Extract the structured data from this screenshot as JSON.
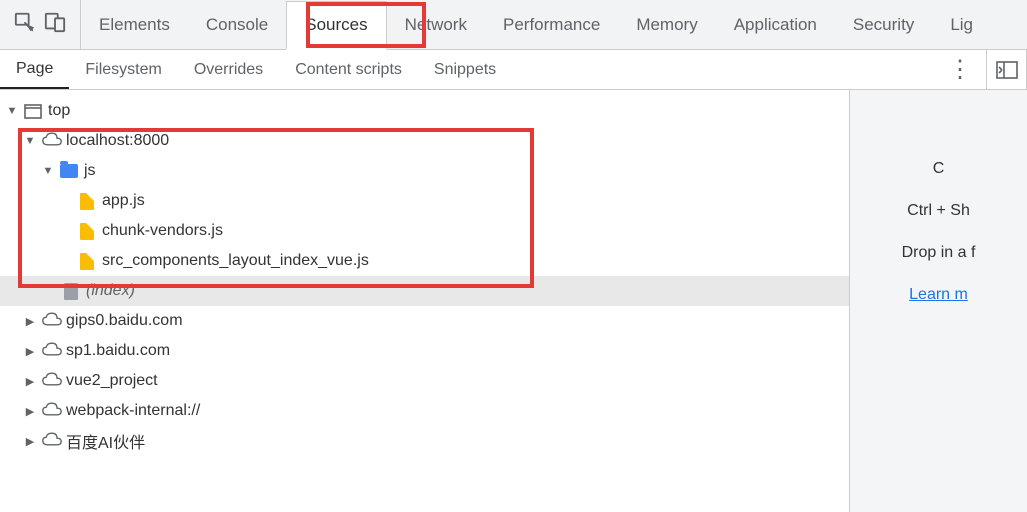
{
  "tabs": {
    "elements": "Elements",
    "console": "Console",
    "sources": "Sources",
    "network": "Network",
    "performance": "Performance",
    "memory": "Memory",
    "application": "Application",
    "security": "Security",
    "lighthouse": "Lig",
    "active": "sources"
  },
  "subtabs": {
    "page": "Page",
    "filesystem": "Filesystem",
    "overrides": "Overrides",
    "content_scripts": "Content scripts",
    "snippets": "Snippets",
    "active": "page"
  },
  "tree": {
    "top": "top",
    "localhost": "localhost:8000",
    "js_folder": "js",
    "files": [
      "app.js",
      "chunk-vendors.js",
      "src_components_layout_index_vue.js"
    ],
    "index": "(index)",
    "domains": [
      "gips0.baidu.com",
      "sp1.baidu.com",
      "vue2_project",
      "webpack-internal://",
      "百度AI伙伴"
    ]
  },
  "right": {
    "line1": "C",
    "line2": "Ctrl + Sh",
    "line3": "Drop in a f",
    "link": "Learn m"
  }
}
